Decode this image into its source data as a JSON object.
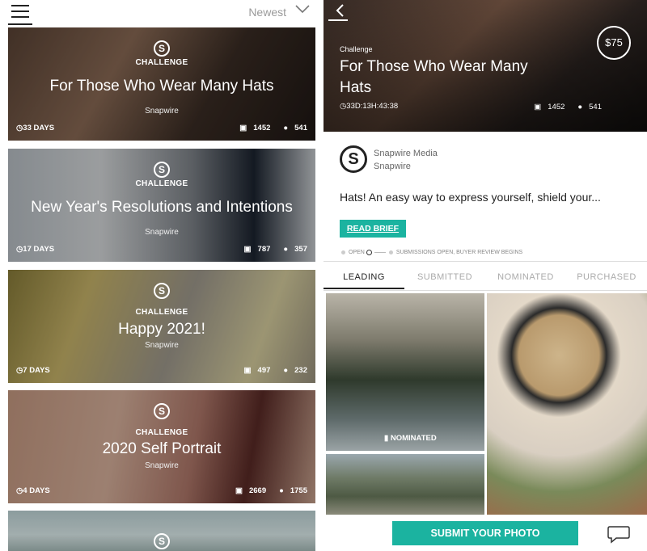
{
  "left": {
    "sort_label": "Newest",
    "cards": [
      {
        "kind": "CHALLENGE",
        "title": "For Those Who Wear Many Hats",
        "by": "Snapwire",
        "days": "33 DAYS",
        "photos": "1452",
        "people": "541"
      },
      {
        "kind": "CHALLENGE",
        "title": "New Year's Resolutions and Intentions",
        "by": "Snapwire",
        "days": "17 DAYS",
        "photos": "787",
        "people": "357"
      },
      {
        "kind": "CHALLENGE",
        "title": "Happy 2021!",
        "by": "Snapwire",
        "days": "7 DAYS",
        "photos": "497",
        "people": "232"
      },
      {
        "kind": "CHALLENGE",
        "title": "2020 Self Portrait",
        "by": "Snapwire",
        "days": "4 DAYS",
        "photos": "2669",
        "people": "1755"
      }
    ],
    "logo_glyph": "S"
  },
  "right": {
    "price": "$75",
    "kind": "Challenge",
    "title": "For Those Who Wear Many Hats",
    "timer": "33D:13H:43:38",
    "photos": "1452",
    "people": "541",
    "org_name": "Snapwire Media",
    "org_sub": "Snapwire",
    "description": "Hats! An easy way to express yourself, shield your...",
    "brief_button": "READ BRIEF",
    "progress_open": "OPEN",
    "progress_status": "SUBMISSIONS OPEN, BUYER REVIEW BEGINS",
    "tabs": [
      "LEADING",
      "SUBMITTED",
      "NOMINATED",
      "PURCHASED"
    ],
    "nominated_label": "NOMINATED",
    "submit_button": "SUBMIT YOUR PHOTO",
    "logo_glyph": "S"
  },
  "icons": [
    "menu-icon",
    "chevron-down-icon",
    "snapwire-logo-icon",
    "clock-icon",
    "camera-icon",
    "person-icon",
    "back-arrow-icon",
    "bookmark-icon",
    "chat-bubble-icon"
  ],
  "colors": {
    "accent": "#1bb3a0"
  }
}
